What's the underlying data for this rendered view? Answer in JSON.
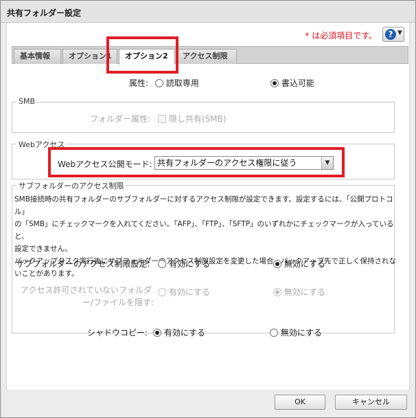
{
  "dialog": {
    "title": "共有フォルダー設定",
    "required_note": "* は必須項目です。",
    "help_label": "?",
    "help_arrow": "▼"
  },
  "tabs": [
    {
      "label": "基本情報"
    },
    {
      "label": "オプション1"
    },
    {
      "label": "オプション2"
    },
    {
      "label": "アクセス制限"
    }
  ],
  "attribute": {
    "label": "属性:",
    "options": [
      "読取専用",
      "書込可能"
    ],
    "selected": "書込可能"
  },
  "smb": {
    "legend": "SMB",
    "folder_attr_label": "フォルダー属性:",
    "hidden_share_label": "隠し共有(SMB)"
  },
  "web_access": {
    "legend": "Webアクセス",
    "mode_label": "Webアクセス公開モード:",
    "mode_value": "共有フォルダーのアクセス権限に従う",
    "dropdown_arrow": "▼"
  },
  "subfolder": {
    "legend": "サブフォルダーのアクセス制限",
    "desc_lines": [
      "SMB接続時の共有フォルダーのサブフォルダーに対するアクセス制限が設定できます。設定するには、「公開プロトコル」",
      "の「SMB」にチェックマークを入れてください。「AFP」、「FTP」、「SFTP」のいずれかにチェックマークが入っていると、",
      "設定できません。",
      "バックアップタスク実行後にサブフォルダーのアクセス制限設定を変更した場合、バックアップ先で正しく保持されな",
      "いことがあります。"
    ],
    "restrict_label": "サブフォルダーのアクセス制限設定:",
    "restrict_options": [
      "有効にする",
      "無効にする"
    ],
    "hide_label_line1": "アクセス許可されていないフォルダ",
    "hide_label_line2": "ー/ファイルを隠す:",
    "hide_options": [
      "有効にする",
      "無効にする"
    ]
  },
  "shadow_copy": {
    "label": "シャドウコピー:",
    "options": [
      "有効にする",
      "無効にする"
    ]
  },
  "buttons": {
    "ok": "OK",
    "cancel": "キャンセル"
  },
  "highlight_color": "#e01e26"
}
